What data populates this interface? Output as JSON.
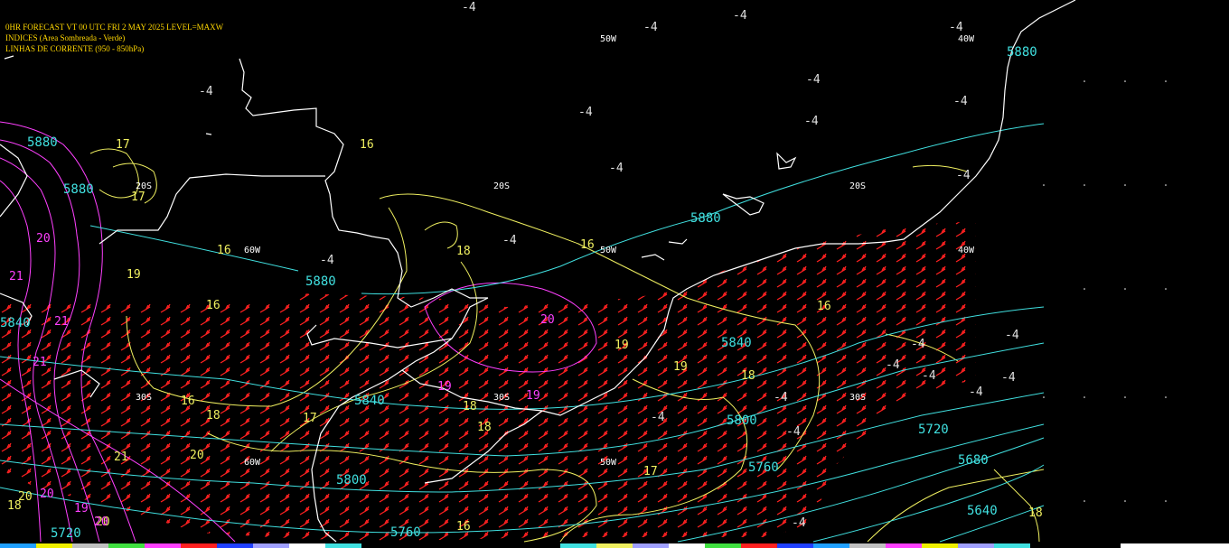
{
  "header": {
    "line1": "0HR FORECAST   VT 00 UTC FRI 2 MAY 2025   LEVEL=MAXW",
    "line2": "INDICES (Area Sombreada - Verde)",
    "line3": "LINHAS DE CORRENTE (950 - 850hPa)"
  },
  "colors": {
    "background": "#000000",
    "coastline": "#ffffff",
    "wind_barbs": "#ff2020",
    "geopotential_contours": "#40e0e0",
    "temperature_contours": "#f0f060",
    "index_contours": "#ff40ff"
  },
  "grid_labels": {
    "lat": [
      "20S",
      "20S",
      "20S",
      "30S",
      "30S",
      "30S"
    ],
    "lon": [
      "60W",
      "60W",
      "50W",
      "50W",
      "50W",
      "40W",
      "40W"
    ]
  },
  "geopotential_labels": [
    "5880",
    "5880",
    "5880",
    "5880",
    "5880",
    "5840",
    "5840",
    "5840",
    "5800",
    "5800",
    "5760",
    "5760",
    "5720",
    "5720",
    "5680",
    "5640"
  ],
  "temperature_labels": [
    "16",
    "16",
    "16",
    "16",
    "16",
    "16",
    "16",
    "17",
    "17",
    "17",
    "17",
    "18",
    "18",
    "18",
    "18",
    "18",
    "18",
    "19",
    "19",
    "19",
    "20",
    "20",
    "20",
    "21",
    "18"
  ],
  "index_labels": [
    "-4",
    "-4",
    "-4",
    "-4",
    "-4",
    "-4",
    "-4",
    "-4",
    "-4",
    "-4",
    "-4",
    "-4",
    "-4",
    "-4",
    "-4",
    "-4",
    "-4",
    "-4",
    "-4",
    "-4",
    "-4",
    "-4",
    "-4"
  ],
  "magenta_labels": [
    "19",
    "19",
    "20",
    "20",
    "20",
    "21",
    "21",
    "21",
    "20",
    "19"
  ]
}
